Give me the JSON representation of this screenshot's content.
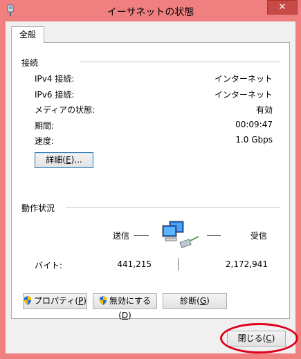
{
  "window": {
    "title": "イーサネットの状態",
    "close_glyph": "✕"
  },
  "tab": {
    "label": "全般"
  },
  "connection": {
    "heading": "接続",
    "rows": [
      {
        "label": "IPv4 接続:",
        "value": "インターネット"
      },
      {
        "label": "IPv6 接続:",
        "value": "インターネット"
      },
      {
        "label": "メディアの状態:",
        "value": "有効"
      },
      {
        "label": "期間:",
        "value": "00:09:47"
      },
      {
        "label": "速度:",
        "value": "1.0 Gbps"
      }
    ],
    "details_button": {
      "text": "詳細(",
      "key": "E",
      "suffix": ")..."
    }
  },
  "activity": {
    "heading": "動作状況",
    "sent_label": "送信",
    "received_label": "受信",
    "bytes_label": "バイト:",
    "bytes_sent": "441,215",
    "bytes_received": "2,172,941"
  },
  "buttons": {
    "properties": {
      "text": "プロパティ(",
      "key": "P",
      "suffix": ")"
    },
    "disable": {
      "text": "無効にする(",
      "key": "D",
      "suffix": ")"
    },
    "diagnose": {
      "text": "診断(",
      "key": "G",
      "suffix": ")"
    },
    "close": {
      "text": "閉じる(",
      "key": "C",
      "suffix": ")"
    }
  },
  "colors": {
    "frame": "#f08080",
    "close_button": "#c74a46",
    "highlight_oval": "#e0001b"
  }
}
